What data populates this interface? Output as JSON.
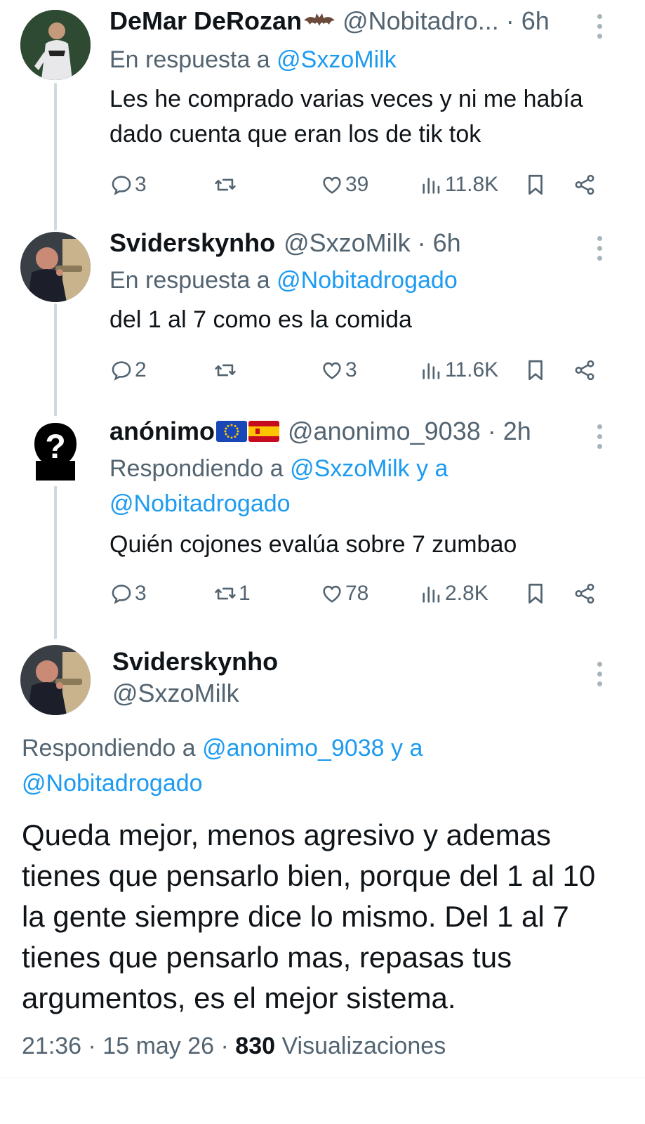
{
  "tweets": [
    {
      "name": "DeMar DeRozan",
      "handle": "@Nobitadro...",
      "time": "· 6h",
      "reply_prefix": "En respuesta a ",
      "reply_link": "@SxzoMilk",
      "text": "Les he comprado varias veces y ni me había dado cuenta que eran los de tik tok",
      "replies": "3",
      "reposts": "",
      "likes": "39",
      "views": "11.8K"
    },
    {
      "name": "Sviderskynho",
      "handle": "@SxzoMilk",
      "time": "· 6h",
      "reply_prefix": "En respuesta a ",
      "reply_link": "@Nobitadrogado",
      "text": "del 1 al 7 como es la comida",
      "replies": "2",
      "reposts": "",
      "likes": "3",
      "views": "11.6K"
    },
    {
      "name": "anónimo",
      "handle": "@anonimo_9038",
      "time": "· 2h",
      "reply_prefix": "Respondiendo a ",
      "reply_link": "@SxzoMilk y a @Nobitadrogado",
      "text": "Quién cojones evalúa sobre 7 zumbao",
      "replies": "3",
      "reposts": "1",
      "likes": "78",
      "views": "2.8K"
    }
  ],
  "main_tweet": {
    "name": "Sviderskynho",
    "handle": "@SxzoMilk",
    "reply_prefix": "Respondiendo a ",
    "reply_link": "@anonimo_9038 y a @Nobitadrogado",
    "text": "Queda mejor, menos agresivo y ademas tienes que pensarlo bien, porque del 1 al 10 la gente siempre dice lo mismo. Del 1 al 7 tienes que pensarlo mas, repasas tus argumentos, es el mejor sistema.",
    "timestamp": "21:36 · 15 may 26 · ",
    "view_count": "830",
    "view_label": " Visualizaciones"
  },
  "icons": [
    "reply-icon",
    "repost-icon",
    "like-icon",
    "views-icon",
    "bookmark-icon",
    "share-icon",
    "more-icon",
    "bat-emoji-icon",
    "eu-flag-icon",
    "spain-flag-icon"
  ],
  "colors": {
    "link": "#1d9bf0",
    "secondary": "#536471",
    "thread_line": "#cfd9de"
  }
}
